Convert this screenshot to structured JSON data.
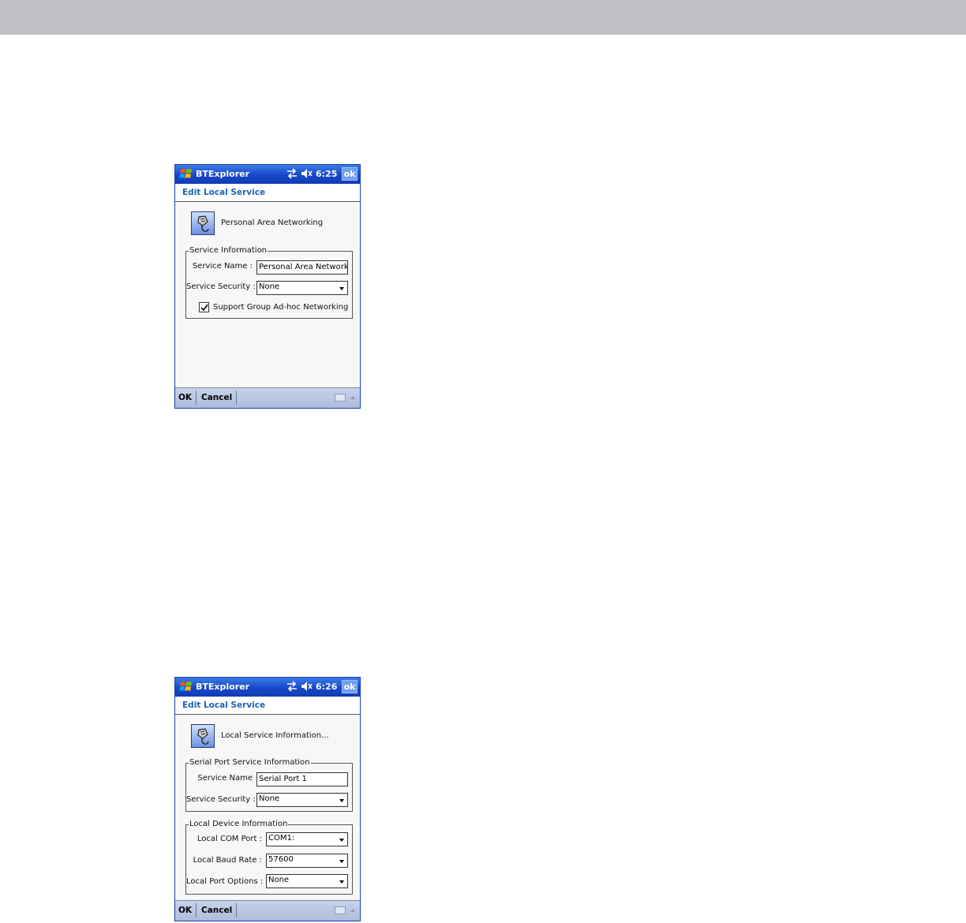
{
  "screenshot1": {
    "title_bar": {
      "app_name": "BTExplorer",
      "time": "6:25",
      "ok_label": "ok",
      "icons": [
        "windows-start-icon",
        "connectivity-icon",
        "speaker-muted-icon"
      ]
    },
    "header": "Edit Local Service",
    "service_label": "Personal Area Networking",
    "group": {
      "legend": "Service Information",
      "service_name_label": "Service Name :",
      "service_name_value": "Personal Area Network",
      "service_security_label": "Service Security :",
      "service_security_value": "None",
      "checkbox_label": "Support Group Ad-hoc Networking",
      "checkbox_checked": true
    },
    "bottom_bar": {
      "ok": "OK",
      "cancel": "Cancel"
    }
  },
  "screenshot2": {
    "title_bar": {
      "app_name": "BTExplorer",
      "time": "6:26",
      "ok_label": "ok",
      "icons": [
        "windows-start-icon",
        "connectivity-icon",
        "speaker-muted-icon"
      ]
    },
    "header": "Edit Local Service",
    "service_label": "Local Service Information...",
    "serial_group": {
      "legend": "Serial Port Service Information",
      "service_name_label": "Service Name",
      "service_name_value": "Serial Port 1",
      "service_security_label": "Service Security :",
      "service_security_value": "None"
    },
    "local_group": {
      "legend": "Local Device Information",
      "com_port_label": "Local COM Port :",
      "com_port_value": "COM1:",
      "baud_rate_label": "Local Baud Rate :",
      "baud_rate_value": "57600",
      "port_options_label": "Local Port Options :",
      "port_options_value": "None"
    },
    "bottom_bar": {
      "ok": "OK",
      "cancel": "Cancel"
    }
  }
}
